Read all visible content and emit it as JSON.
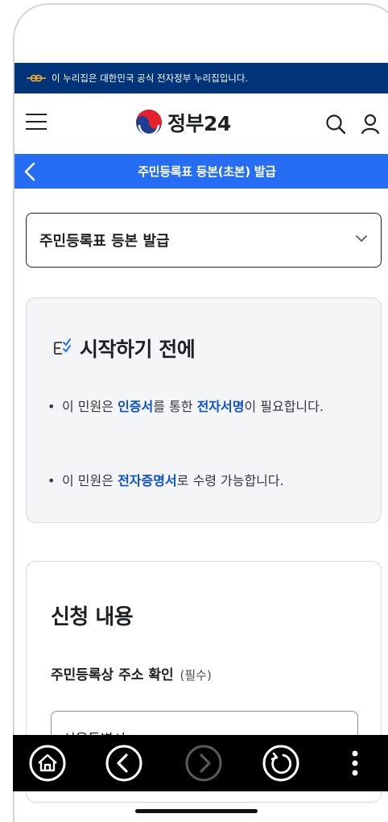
{
  "gov_banner": {
    "text": "이 누리집은 대한민국 공식 전자정부 누리집입니다."
  },
  "header": {
    "logo_text": "정부24",
    "menu_icon": "hamburger-icon",
    "search_icon": "search-icon",
    "user_icon": "user-icon"
  },
  "titlebar": {
    "title": "주민등록표 등본(초본) 발급",
    "back_icon": "chevron-left-icon"
  },
  "service_select": {
    "selected": "주민등록표 등본 발급"
  },
  "notice": {
    "title": "시작하기 전에",
    "bullet1": {
      "prefix": "이 민원은 ",
      "highlight1": "인증서",
      "middle": "를 통한 ",
      "highlight2": "전자서명",
      "suffix": "이 필요합니다."
    },
    "bullet2": {
      "prefix": "이 민원은 ",
      "highlight": "전자증명서",
      "suffix": "로 수령 가능합니다."
    }
  },
  "apply": {
    "title": "신청 내용",
    "address_label": "주민등록상 주소 확인",
    "required": "(필수)",
    "address_value": "서울특별시"
  },
  "colors": {
    "banner_bg": "#003479",
    "titlebar_bg": "#256ef4",
    "highlight": "#0b50d0",
    "notice_bg": "#f4f5f6"
  },
  "navbar": {
    "icons": [
      "home-icon",
      "back-icon",
      "forward-icon",
      "reload-icon",
      "more-icon"
    ]
  }
}
